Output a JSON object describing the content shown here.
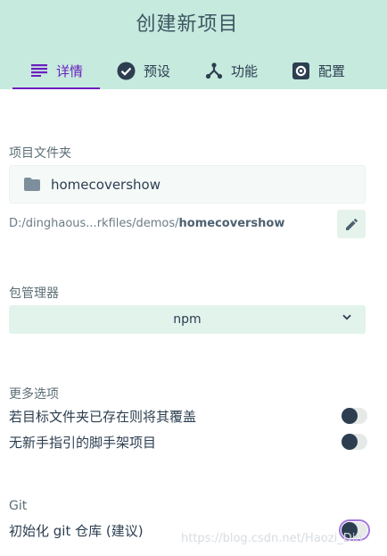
{
  "header": {
    "title": "创建新项目",
    "tabs": [
      {
        "label": "详情",
        "icon": "list-icon",
        "active": true
      },
      {
        "label": "预设",
        "icon": "check-circle-icon",
        "active": false
      },
      {
        "label": "功能",
        "icon": "fork-icon",
        "active": false
      },
      {
        "label": "配置",
        "icon": "gear-icon",
        "active": false
      }
    ]
  },
  "folder": {
    "label": "项目文件夹",
    "value": "homecovershow",
    "path_prefix": "D:/dinghaous...rkfiles/demos/",
    "path_name": "homecovershow"
  },
  "package_manager": {
    "label": "包管理器",
    "selected": "npm"
  },
  "more_options": {
    "label": "更多选项",
    "options": [
      {
        "label": "若目标文件夹已存在则将其覆盖",
        "enabled": false
      },
      {
        "label": "无新手指引的脚手架项目",
        "enabled": false
      }
    ]
  },
  "git": {
    "label": "Git",
    "init_label": "初始化 git 仓库 (建议)",
    "enabled": false
  },
  "watermark": "https://blog.csdn.net/Haozi_Din",
  "colors": {
    "header_bg": "#c6eade",
    "accent": "#6a1fbe",
    "dark": "#2c3e50"
  }
}
